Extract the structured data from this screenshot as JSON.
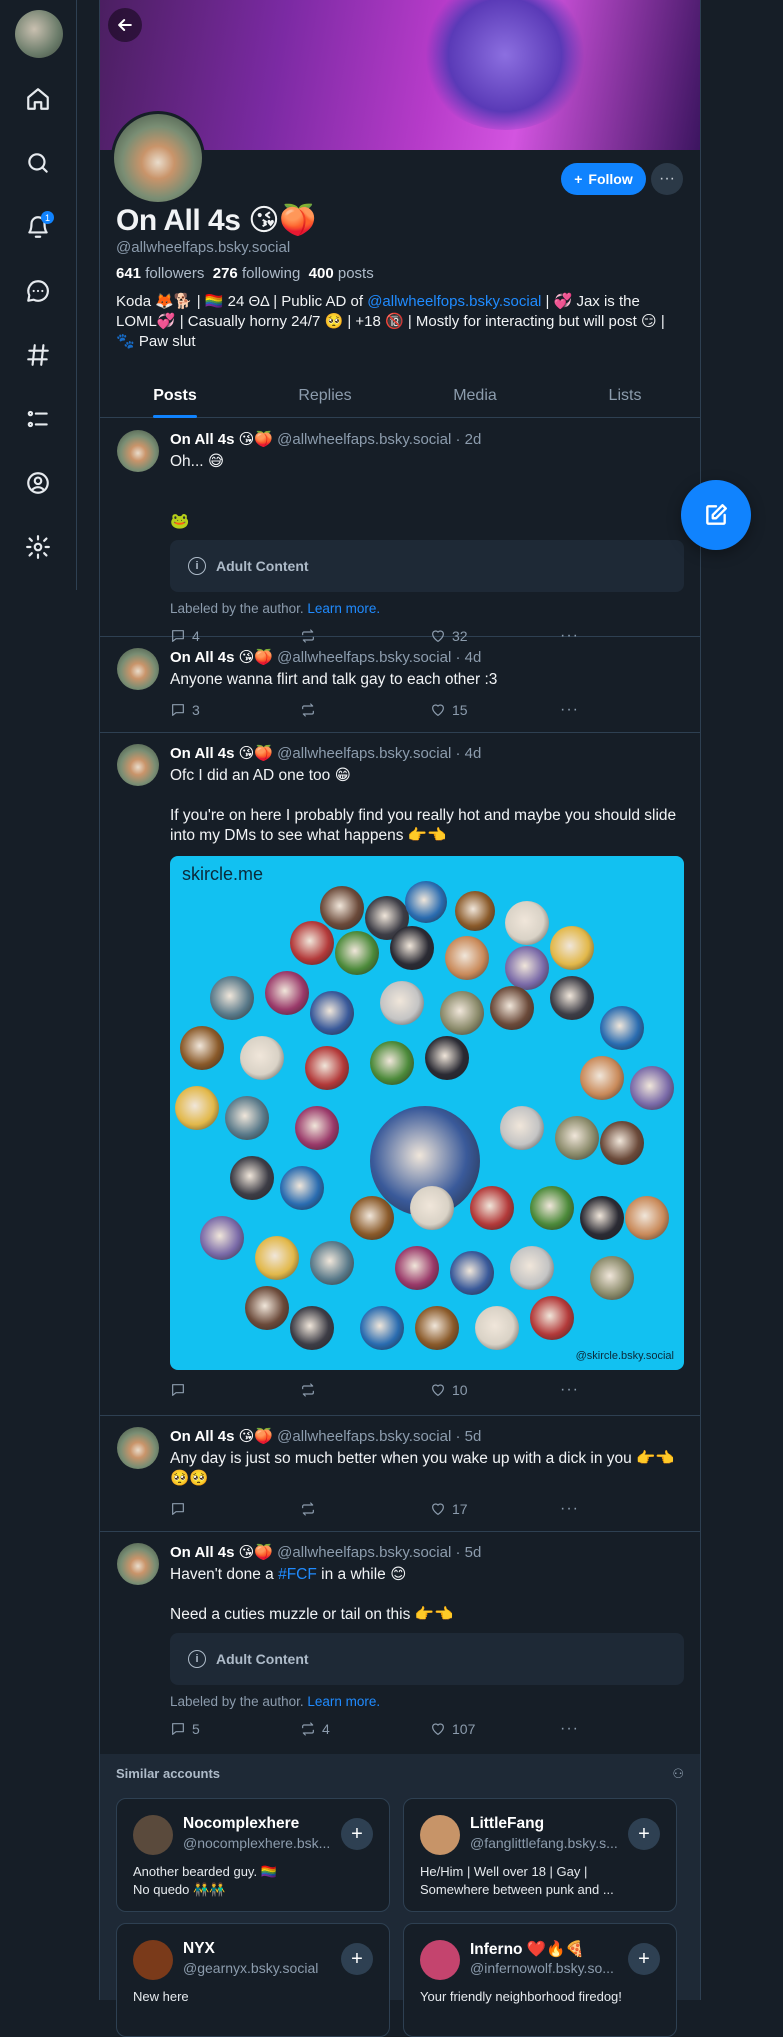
{
  "nav": {
    "notification_count": "1",
    "items": [
      "home-icon",
      "search-icon",
      "bell-icon",
      "chat-icon",
      "hashtag-icon",
      "list-icon",
      "profile-icon",
      "settings-icon"
    ]
  },
  "profile": {
    "display_name": "On All 4s 😘🍑",
    "handle": "@allwheelfaps.bsky.social",
    "followers_count": "641",
    "followers_label": "followers",
    "following_count": "276",
    "following_label": "following",
    "posts_count": "400",
    "posts_label": "posts",
    "bio_part1": "Koda 🦊🐕 | 🏳️‍🌈 24 ΘΔ | Public AD of ",
    "bio_link": "@allwheelfops.bsky.social",
    "bio_part2": " | 💞 Jax is the LOML💞 | Casually horny 24/7 🥺 | +18 🔞 | Mostly for interacting but will post 😏 | 🐾 Paw slut",
    "follow_label": "Follow",
    "more_label": "···"
  },
  "tabs": [
    "Posts",
    "Replies",
    "Media",
    "Lists"
  ],
  "posts": [
    {
      "name": "On All 4s 😘🍑",
      "meta": " @allwheelfaps.bsky.social · 2d",
      "text": "Oh... 😅\n\n\n🐸",
      "adult_label": "Adult Content",
      "labeled_text": "Labeled by the author. ",
      "learn_more": "Learn more.",
      "replies": "4",
      "reposts": "",
      "likes": "32"
    },
    {
      "name": "On All 4s 😘🍑",
      "meta": " @allwheelfaps.bsky.social · 4d",
      "text": "Anyone wanna flirt and talk gay to each other :3",
      "replies": "3",
      "reposts": "",
      "likes": "15"
    },
    {
      "name": "On All 4s 😘🍑",
      "meta": " @allwheelfaps.bsky.social · 4d",
      "text": "Ofc I did an AD one too 😁\n\nIf you're on here I probably find you really hot and maybe you should slide into my DMs to see what happens 👉👈",
      "image_title": "skircle.me",
      "image_footer": "@skircle.bsky.social",
      "replies": "",
      "reposts": "",
      "likes": "10"
    },
    {
      "name": "On All 4s 😘🍑",
      "meta": " @allwheelfaps.bsky.social · 5d",
      "text": "Any day is just so much better when you wake up with a dick in you 👉👈 🥺🥺",
      "replies": "",
      "reposts": "",
      "likes": "17"
    },
    {
      "name": "On All 4s 😘🍑",
      "meta": " @allwheelfaps.bsky.social · 5d",
      "text_part1": "Haven't done a ",
      "text_tag": "#FCF",
      "text_part2": " in a while 😊\n\nNeed a cuties muzzle or tail on this 👉👈",
      "adult_label": "Adult Content",
      "labeled_text": "Labeled by the author. ",
      "learn_more": "Learn more.",
      "replies": "5",
      "reposts": "4",
      "likes": "107"
    }
  ],
  "similar": {
    "title": "Similar accounts",
    "accounts": [
      {
        "name": "Nocomplexhere",
        "handle": "@nocomplexhere.bsk...",
        "desc": "Another bearded guy. 🏳️‍🌈\nNo quedo 👬👬",
        "color": "#5a4a3c"
      },
      {
        "name": "LittleFang",
        "handle": "@fanglittlefang.bsky.s...",
        "desc": "He/Him | Well over 18 | Gay |\nSomewhere between punk and ...",
        "color": "#c79468"
      },
      {
        "name": "NYX",
        "handle": "@gearnyx.bsky.social",
        "desc": "New here",
        "color": "#7a3a1a"
      },
      {
        "name": "Inferno ❤️🔥🍕",
        "handle": "@infernowolf.bsky.so...",
        "desc": "Your friendly neighborhood firedog!",
        "color": "#c4446e"
      }
    ]
  }
}
